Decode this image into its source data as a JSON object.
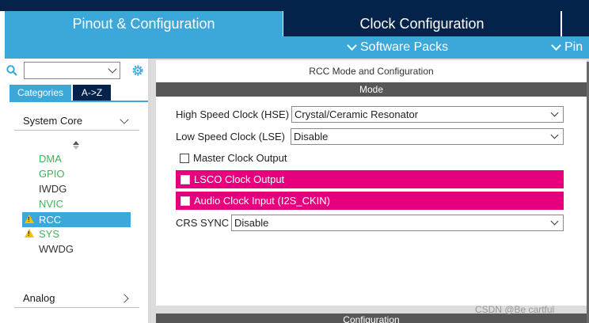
{
  "header": {
    "tab_pinout": "Pinout & Configuration",
    "tab_clock": "Clock Configuration",
    "software_packs": "Software Packs",
    "pinout_trunc": "Pin"
  },
  "sidebar": {
    "search_value": "",
    "tab_categories": "Categories",
    "tab_az": "A->Z",
    "group_system_core": "System Core",
    "group_analog": "Analog",
    "peripherals": [
      {
        "label": "DMA",
        "color": "#3db35a"
      },
      {
        "label": "GPIO",
        "color": "#3db35a"
      },
      {
        "label": "IWDG",
        "color": "#333333"
      },
      {
        "label": "NVIC",
        "color": "#3db35a"
      },
      {
        "label": "RCC",
        "warning": true,
        "selected": true
      },
      {
        "label": "SYS",
        "warning": true,
        "color": "#3db35a"
      },
      {
        "label": "WWDG",
        "color": "#333333"
      }
    ]
  },
  "main": {
    "title": "RCC Mode and Configuration",
    "mode_header": "Mode",
    "hse_label": "High Speed Clock (HSE)",
    "hse_value": "Crystal/Ceramic Resonator",
    "lse_label": "Low Speed Clock (LSE)",
    "lse_value": "Disable",
    "mco_label": "Master Clock Output",
    "lsco_label": "LSCO Clock Output",
    "audio_label": "Audio Clock Input (I2S_CKIN)",
    "crs_label": "CRS SYNC",
    "crs_value": "Disable",
    "config_header": "Configuration"
  },
  "watermark": "CSDN @Be cartful",
  "colors": {
    "accent_blue": "#3ca7d9",
    "navy": "#03234b",
    "pink_highlight": "#e6007e",
    "green_ok": "#3db35a",
    "warning_yellow": "#f2c200"
  }
}
